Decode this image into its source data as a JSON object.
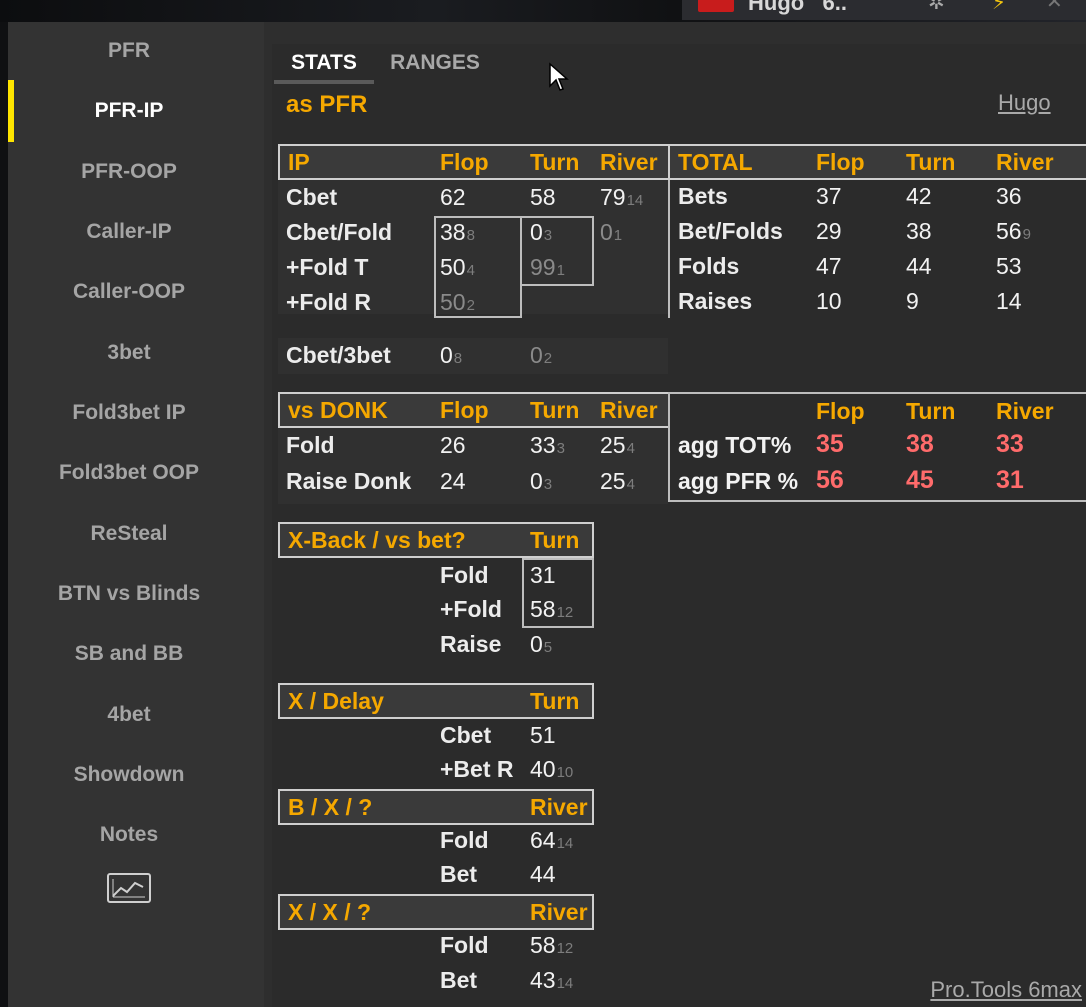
{
  "titlebar": {
    "player": "Hugo",
    "stack": "6.."
  },
  "sidebar": {
    "items": [
      "PFR",
      "PFR-IP",
      "PFR-OOP",
      "Caller-IP",
      "Caller-OOP",
      "3bet",
      "Fold3bet IP",
      "Fold3bet OOP",
      "ReSteal",
      "BTN vs Blinds",
      "SB and BB",
      "4bet",
      "Showdown",
      "Notes"
    ],
    "active": "PFR-IP",
    "chart_icon": "line-chart-icon"
  },
  "tabs": {
    "stats": "STATS",
    "ranges": "RANGES",
    "active": "STATS"
  },
  "section": {
    "title": "as PFR",
    "player_link": "Hugo"
  },
  "ip_table": {
    "header": [
      "IP",
      "Flop",
      "Turn",
      "River"
    ],
    "rows": [
      {
        "label": "Cbet",
        "flop": "62",
        "flop_n": "",
        "turn": "58",
        "turn_n": "",
        "river": "79",
        "river_n": "14"
      },
      {
        "label": "Cbet/Fold",
        "flop": "38",
        "flop_n": "8",
        "turn": "0",
        "turn_n": "3",
        "river": "0",
        "river_n": "1"
      },
      {
        "label": "+Fold T",
        "flop": "50",
        "flop_n": "4",
        "turn": "99",
        "turn_n": "1"
      },
      {
        "label": "+Fold R",
        "flop": "50",
        "flop_n": "2"
      }
    ]
  },
  "total_table": {
    "header": [
      "TOTAL",
      "Flop",
      "Turn",
      "River"
    ],
    "rows": [
      {
        "label": "Bets",
        "flop": "37",
        "turn": "42",
        "river": "36",
        "river_n": ""
      },
      {
        "label": "Bet/Folds",
        "flop": "29",
        "turn": "38",
        "river": "56",
        "river_n": "9"
      },
      {
        "label": "Folds",
        "flop": "47",
        "turn": "44",
        "river": "53",
        "river_n": ""
      },
      {
        "label": "Raises",
        "flop": "10",
        "turn": "9",
        "river": "14",
        "river_n": ""
      }
    ]
  },
  "cbet3bet": {
    "label": "Cbet/3bet",
    "flop": "0",
    "flop_n": "8",
    "turn": "0",
    "turn_n": "2"
  },
  "vs_donk": {
    "header": [
      "vs DONK",
      "Flop",
      "Turn",
      "River"
    ],
    "rows": [
      {
        "label": "Fold",
        "flop": "26",
        "turn": "33",
        "turn_n": "3",
        "river": "25",
        "river_n": "4"
      },
      {
        "label": "Raise Donk",
        "flop": "24",
        "turn": "0",
        "turn_n": "3",
        "river": "25",
        "river_n": "4"
      }
    ]
  },
  "agg": {
    "header": [
      "Flop",
      "Turn",
      "River"
    ],
    "rows": [
      {
        "label": "agg TOT%",
        "flop": "35",
        "turn": "38",
        "river": "33"
      },
      {
        "label": "agg PFR %",
        "flop": "56",
        "turn": "45",
        "river": "31"
      }
    ],
    "value_color": "#ff6b6b"
  },
  "xback": {
    "header": [
      "X-Back / vs bet?",
      "Turn"
    ],
    "rows": [
      {
        "label": "Fold",
        "val": "31",
        "n": ""
      },
      {
        "label": "+Fold",
        "val": "58",
        "n": "12"
      },
      {
        "label": "Raise",
        "val": "0",
        "n": "5"
      }
    ]
  },
  "xdelay": {
    "header": [
      "X / Delay",
      "Turn"
    ],
    "rows": [
      {
        "label": "Cbet",
        "val": "51",
        "n": ""
      },
      {
        "label": "+Bet R",
        "val": "40",
        "n": "10"
      }
    ]
  },
  "bx": {
    "header": [
      "B / X / ?",
      "River"
    ],
    "rows": [
      {
        "label": "Fold",
        "val": "64",
        "n": "14"
      },
      {
        "label": "Bet",
        "val": "44",
        "n": ""
      }
    ]
  },
  "xx": {
    "header": [
      "X / X / ?",
      "River"
    ],
    "rows": [
      {
        "label": "Fold",
        "val": "58",
        "n": "12"
      },
      {
        "label": "Bet",
        "val": "43",
        "n": "14"
      }
    ]
  },
  "footer": "Pro.Tools 6max",
  "colors": {
    "accent": "#f5a800",
    "active_marker": "#ffe500",
    "agg_red": "#ff6b6b"
  }
}
